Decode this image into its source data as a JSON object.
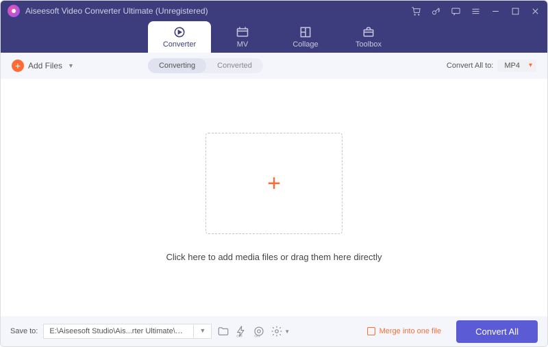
{
  "title": "Aiseesoft Video Converter Ultimate (Unregistered)",
  "tabs": {
    "converter": "Converter",
    "mv": "MV",
    "collage": "Collage",
    "toolbox": "Toolbox"
  },
  "toolbar": {
    "add": "Add Files",
    "converting": "Converting",
    "converted": "Converted",
    "convert_all": "Convert All to:",
    "format": "MP4"
  },
  "dropzone": {
    "hint": "Click here to add media files or drag them here directly"
  },
  "footer": {
    "save": "Save to:",
    "path": "E:\\Aiseesoft Studio\\Ais...rter Ultimate\\Converted",
    "merge": "Merge into one file",
    "convert": "Convert All"
  }
}
